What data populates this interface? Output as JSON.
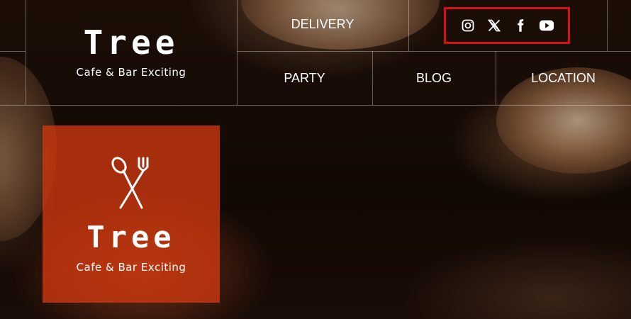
{
  "brand": {
    "name": "Tree",
    "tagline": "Cafe & Bar Exciting"
  },
  "nav": {
    "top": [
      "DELIVERY"
    ],
    "bottom": [
      "PARTY",
      "BLOG",
      "LOCATION"
    ]
  },
  "social": {
    "icons": [
      "instagram-icon",
      "x-icon",
      "facebook-icon",
      "youtube-icon"
    ]
  },
  "card": {
    "name": "Tree",
    "tagline": "Cafe & Bar Exciting",
    "icon": "utensils-icon"
  },
  "colors": {
    "card_bg": "#c8370f",
    "highlight_border": "#d21414",
    "text": "#ffffff"
  }
}
